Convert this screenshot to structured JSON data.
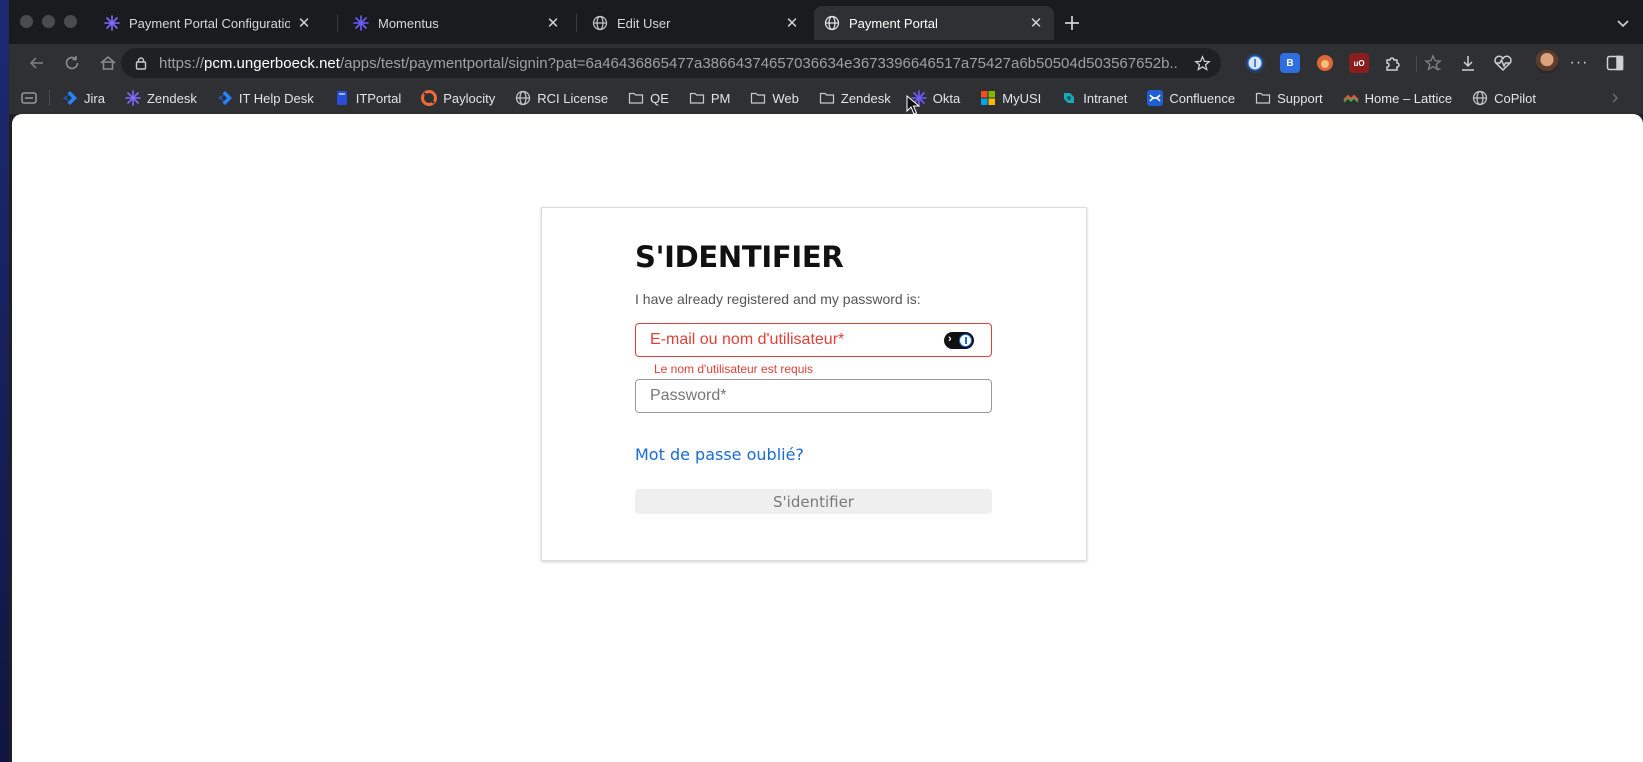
{
  "browser": {
    "tabs": [
      {
        "title": "Payment Portal Configurations - ",
        "icon": "zendesk-star-icon",
        "active": false
      },
      {
        "title": "Momentus",
        "icon": "zendesk-star-icon",
        "active": false
      },
      {
        "title": "Edit User",
        "icon": "globe-icon",
        "active": false
      },
      {
        "title": "Payment Portal",
        "icon": "globe-icon",
        "active": true
      }
    ],
    "url": {
      "scheme": "https://",
      "host": "pcm.ungerboeck.net",
      "path": "/apps/test/paymentportal/signin?pat=6a46436865477a38664374657036634e3673396646517a75427a6b50504d503567652b..."
    },
    "bookmarks": [
      {
        "label": "Jira",
        "icon": "jira-icon"
      },
      {
        "label": "Zendesk",
        "icon": "zendesk-star-icon"
      },
      {
        "label": "IT Help Desk",
        "icon": "jira-icon"
      },
      {
        "label": "ITPortal",
        "icon": "bookmark-blue-icon"
      },
      {
        "label": "Paylocity",
        "icon": "paylocity-icon"
      },
      {
        "label": "RCI License",
        "icon": "globe-icon"
      },
      {
        "label": "QE",
        "icon": "folder-icon"
      },
      {
        "label": "PM",
        "icon": "folder-icon"
      },
      {
        "label": "Web",
        "icon": "folder-icon"
      },
      {
        "label": "Zendesk",
        "icon": "folder-icon"
      },
      {
        "label": "Okta",
        "icon": "zendesk-star-icon"
      },
      {
        "label": "MyUSI",
        "icon": "microsoft-icon"
      },
      {
        "label": "Intranet",
        "icon": "intranet-icon"
      },
      {
        "label": "Confluence",
        "icon": "confluence-icon"
      },
      {
        "label": "Support",
        "icon": "folder-icon"
      },
      {
        "label": "Home – Lattice",
        "icon": "lattice-icon"
      },
      {
        "label": "CoPilot",
        "icon": "globe-icon"
      }
    ]
  },
  "signin": {
    "title": "S'IDENTIFIER",
    "subtitle": "I have already registered and my password is:",
    "email_placeholder": "E-mail ou nom d'utilisateur*",
    "email_error": "Le nom d'utilisateur est requis",
    "password_placeholder": "Password*",
    "forgot_link": "Mot de passe oublié?",
    "submit_label": "S'identifier"
  },
  "colors": {
    "error": "#e0403a",
    "link": "#1a6ad6",
    "accent_star": "#6c5cff"
  }
}
